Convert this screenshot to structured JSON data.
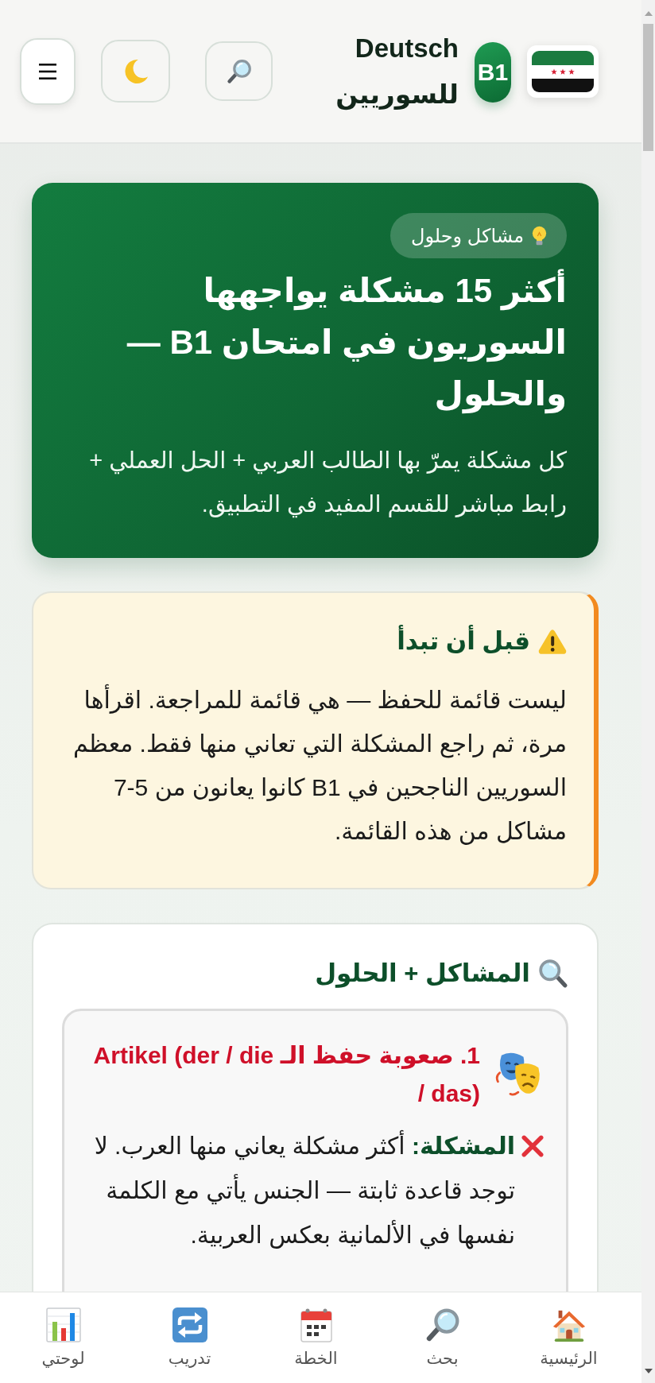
{
  "header": {
    "level_badge": "B1",
    "title": "Deutsch للسوريين"
  },
  "hero": {
    "badge": "مشاكل وحلول",
    "title": "أكثر 15 مشكلة يواجهها السوريون في امتحان B1 — والحلول",
    "subtitle": "كل مشكلة يمرّ بها الطالب العربي + الحل العملي + رابط مباشر للقسم المفيد في التطبيق."
  },
  "notice": {
    "title": "قبل أن تبدأ",
    "text": "ليست قائمة للحفظ — هي قائمة للمراجعة. اقرأها مرة، ثم راجع المشكلة التي تعاني منها فقط. معظم السوريين الناجحين في B1 كانوا يعانون من 5-7 مشاكل من هذه القائمة."
  },
  "problems": {
    "title": "المشاكل + الحلول",
    "items": [
      {
        "title": "1. صعوبة حفظ الـ Artikel (der / die / das)",
        "text": "**المشكلة:** أكثر مشكلة يعاني منها العرب. لا توجد قاعدة ثابتة — الجنس يأتي مع الكلمة نفسها في الألمانية بعكس العربية."
      }
    ]
  },
  "bottom_nav": [
    {
      "label": "الرئيسية",
      "kind": "home"
    },
    {
      "label": "بحث",
      "kind": "search"
    },
    {
      "label": "الخطة",
      "kind": "calendar"
    },
    {
      "label": "تدريب",
      "kind": "repeat"
    },
    {
      "label": "لوحتي",
      "kind": "chart"
    }
  ]
}
